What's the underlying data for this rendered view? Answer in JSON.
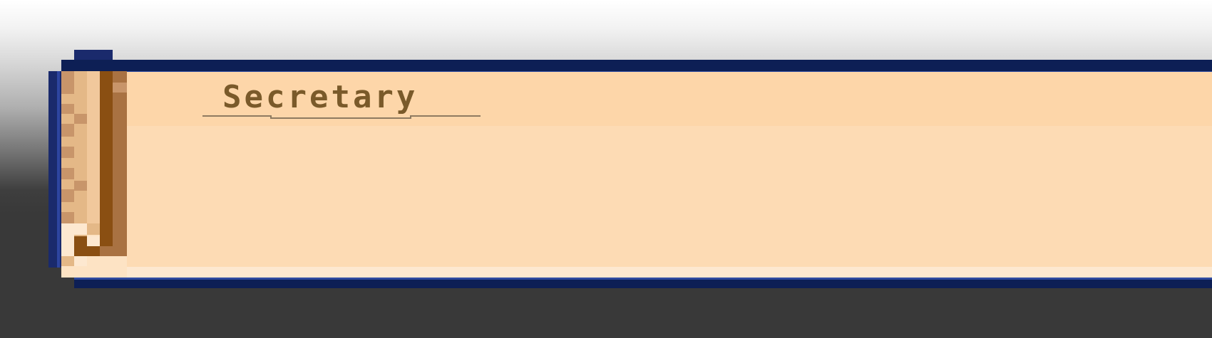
{
  "dialog": {
    "speaker_name": "Secretary",
    "colors": {
      "frame_dark": "#0d1f55",
      "frame_mid": "#1a2a6c",
      "frame_light": "#2e4aa0",
      "title_band": "#fdd6a9",
      "panel": "#fddbb4",
      "name_text": "#7a5a2a",
      "scroll_wood": "#c8956a",
      "scroll_dark": "#8a4f12"
    },
    "icons": {
      "scroll_edge": "scroll-edge-icon",
      "name_underline": "name-underline-icon"
    }
  }
}
